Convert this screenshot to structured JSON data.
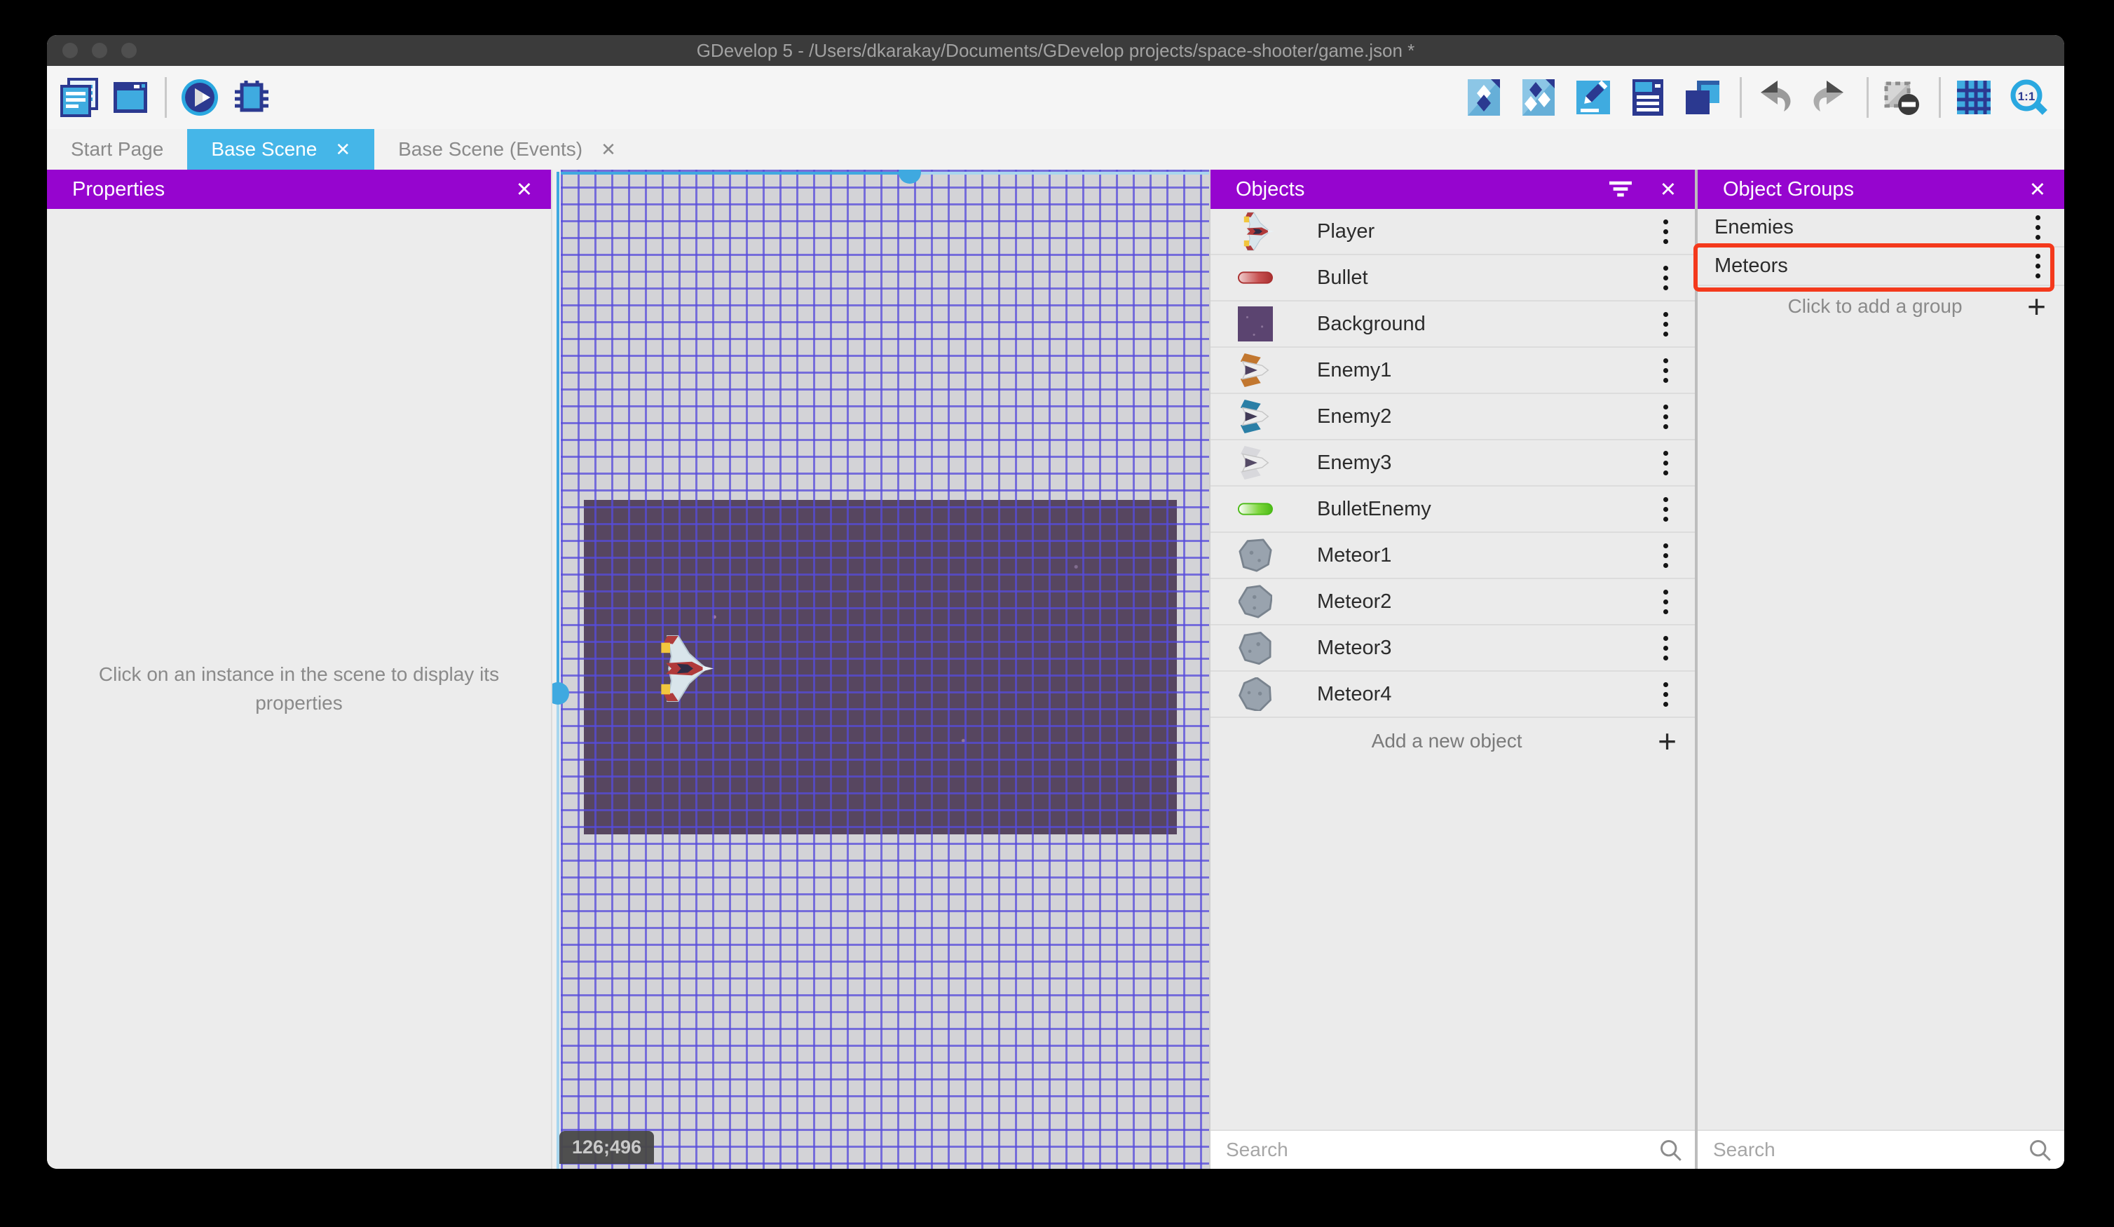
{
  "window": {
    "title": "GDevelop 5 - /Users/dkarakay/Documents/GDevelop projects/space-shooter/game.json *"
  },
  "toolbar": {
    "left_icons": [
      "project-manager-icon",
      "start-page-icon",
      "play-icon",
      "debug-icon"
    ],
    "right_icons": [
      "objects-panel-icon",
      "object-groups-panel-icon",
      "properties-panel-icon",
      "instances-list-icon",
      "layers-icon",
      "undo-icon",
      "redo-icon",
      "toggle-mask-icon",
      "toggle-grid-icon",
      "zoom-original-icon"
    ]
  },
  "tabs": [
    {
      "label": "Start Page",
      "active": false,
      "closable": false
    },
    {
      "label": "Base Scene",
      "active": true,
      "closable": true
    },
    {
      "label": "Base Scene (Events)",
      "active": false,
      "closable": true
    }
  ],
  "properties_panel": {
    "title": "Properties",
    "empty_message": "Click on an instance in the scene to display its properties"
  },
  "scene_canvas": {
    "coordinate_indicator": "126;496"
  },
  "objects_panel": {
    "title": "Objects",
    "items": [
      {
        "label": "Player",
        "icon": "player-ship"
      },
      {
        "label": "Bullet",
        "icon": "red-bullet"
      },
      {
        "label": "Background",
        "icon": "background-tile"
      },
      {
        "label": "Enemy1",
        "icon": "enemy1-ship"
      },
      {
        "label": "Enemy2",
        "icon": "enemy2-ship"
      },
      {
        "label": "Enemy3",
        "icon": "enemy3-ship"
      },
      {
        "label": "BulletEnemy",
        "icon": "green-bullet"
      },
      {
        "label": "Meteor1",
        "icon": "meteor1"
      },
      {
        "label": "Meteor2",
        "icon": "meteor2"
      },
      {
        "label": "Meteor3",
        "icon": "meteor3"
      },
      {
        "label": "Meteor4",
        "icon": "meteor4"
      }
    ],
    "add_button_label": "Add a new object",
    "search_placeholder": "Search"
  },
  "object_groups_panel": {
    "title": "Object Groups",
    "groups": [
      {
        "label": "Enemies",
        "highlighted": false
      },
      {
        "label": "Meteors",
        "highlighted": true
      }
    ],
    "add_button_label": "Click to add a group",
    "search_placeholder": "Search"
  },
  "colors": {
    "header_purple": "#9605CF",
    "active_tab_blue": "#45B6E8",
    "selection_blue": "#3FA9E0",
    "highlight_red": "#F4391C"
  }
}
